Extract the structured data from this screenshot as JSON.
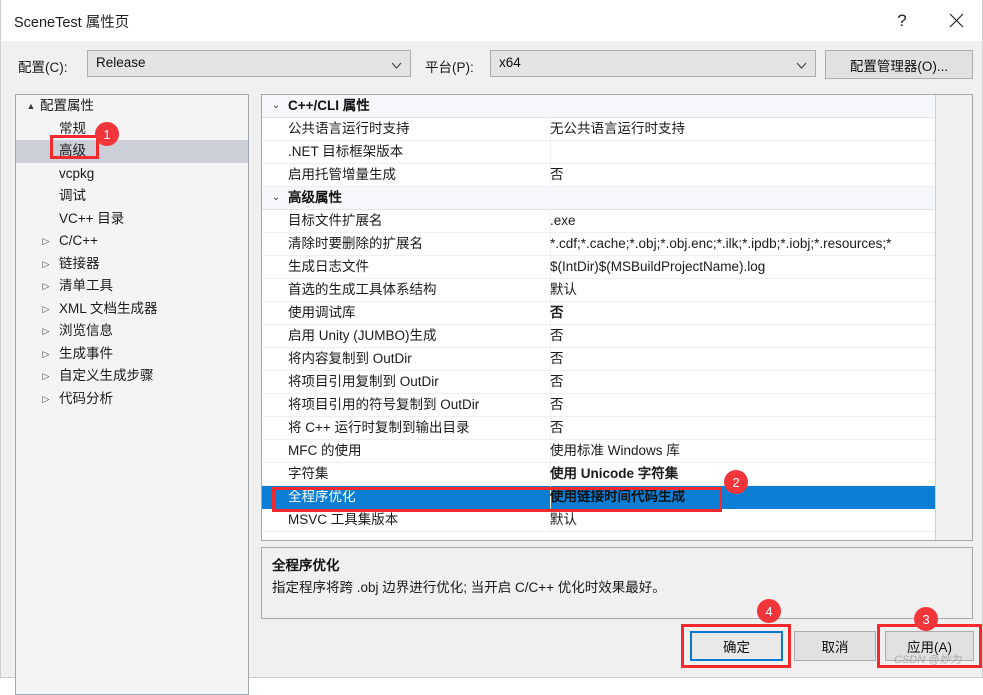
{
  "window": {
    "title": "SceneTest 属性页",
    "help_icon": "?",
    "close_icon": "close-icon"
  },
  "toolbar": {
    "config_label": "配置(C):",
    "config_value": "Release",
    "platform_label": "平台(P):",
    "platform_value": "x64",
    "config_manager_label": "配置管理器(O)..."
  },
  "tree": {
    "items": [
      {
        "label": "配置属性",
        "level": "root",
        "arrow": "▲",
        "selected": false
      },
      {
        "label": "常规",
        "level": "leaf",
        "arrow": "",
        "selected": false
      },
      {
        "label": "高级",
        "level": "leaf",
        "arrow": "",
        "selected": true
      },
      {
        "label": "vcpkg",
        "level": "leaf",
        "arrow": "",
        "selected": false
      },
      {
        "label": "调试",
        "level": "leaf",
        "arrow": "",
        "selected": false
      },
      {
        "label": "VC++ 目录",
        "level": "leaf",
        "arrow": "",
        "selected": false
      },
      {
        "label": "C/C++",
        "level": "node",
        "arrow": "▷",
        "selected": false
      },
      {
        "label": "链接器",
        "level": "node",
        "arrow": "▷",
        "selected": false
      },
      {
        "label": "清单工具",
        "level": "node",
        "arrow": "▷",
        "selected": false
      },
      {
        "label": "XML 文档生成器",
        "level": "node",
        "arrow": "▷",
        "selected": false
      },
      {
        "label": "浏览信息",
        "level": "node",
        "arrow": "▷",
        "selected": false
      },
      {
        "label": "生成事件",
        "level": "node",
        "arrow": "▷",
        "selected": false
      },
      {
        "label": "自定义生成步骤",
        "level": "node",
        "arrow": "▷",
        "selected": false
      },
      {
        "label": "代码分析",
        "level": "node",
        "arrow": "▷",
        "selected": false
      }
    ]
  },
  "grid": {
    "rows": [
      {
        "kind": "category",
        "name": "C++/CLI 属性",
        "value": "",
        "caret": "⌄",
        "bold": false,
        "selected": false
      },
      {
        "kind": "prop",
        "name": "公共语言运行时支持",
        "value": "无公共语言运行时支持",
        "bold": false,
        "selected": false
      },
      {
        "kind": "prop",
        "name": ".NET 目标框架版本",
        "value": "",
        "bold": false,
        "selected": false
      },
      {
        "kind": "prop",
        "name": "启用托管增量生成",
        "value": "否",
        "bold": false,
        "selected": false
      },
      {
        "kind": "category",
        "name": "高级属性",
        "value": "",
        "caret": "⌄",
        "bold": false,
        "selected": false
      },
      {
        "kind": "prop",
        "name": "目标文件扩展名",
        "value": ".exe",
        "bold": false,
        "selected": false
      },
      {
        "kind": "prop",
        "name": "清除时要删除的扩展名",
        "value": "*.cdf;*.cache;*.obj;*.obj.enc;*.ilk;*.ipdb;*.iobj;*.resources;*",
        "bold": false,
        "selected": false
      },
      {
        "kind": "prop",
        "name": "生成日志文件",
        "value": "$(IntDir)$(MSBuildProjectName).log",
        "bold": false,
        "selected": false
      },
      {
        "kind": "prop",
        "name": "首选的生成工具体系结构",
        "value": "默认",
        "bold": false,
        "selected": false
      },
      {
        "kind": "prop",
        "name": "使用调试库",
        "value": "否",
        "bold": true,
        "selected": false
      },
      {
        "kind": "prop",
        "name": "启用 Unity (JUMBO)生成",
        "value": "否",
        "bold": false,
        "selected": false
      },
      {
        "kind": "prop",
        "name": "将内容复制到 OutDir",
        "value": "否",
        "bold": false,
        "selected": false
      },
      {
        "kind": "prop",
        "name": "将项目引用复制到 OutDir",
        "value": "否",
        "bold": false,
        "selected": false
      },
      {
        "kind": "prop",
        "name": "将项目引用的符号复制到 OutDir",
        "value": "否",
        "bold": false,
        "selected": false
      },
      {
        "kind": "prop",
        "name": "将 C++ 运行时复制到输出目录",
        "value": "否",
        "bold": false,
        "selected": false
      },
      {
        "kind": "prop",
        "name": "MFC 的使用",
        "value": "使用标准 Windows 库",
        "bold": false,
        "selected": false
      },
      {
        "kind": "prop",
        "name": "字符集",
        "value": "使用 Unicode 字符集",
        "bold": true,
        "selected": false
      },
      {
        "kind": "prop",
        "name": "全程序优化",
        "value": "使用链接时间代码生成",
        "bold": true,
        "selected": true
      },
      {
        "kind": "prop",
        "name": "MSVC 工具集版本",
        "value": "默认",
        "bold": false,
        "selected": false
      }
    ]
  },
  "description": {
    "title": "全程序优化",
    "body": "指定程序将跨 .obj 边界进行优化; 当开启 C/C++ 优化时效果最好。"
  },
  "footer": {
    "ok_label": "确定",
    "cancel_label": "取消",
    "apply_label": "应用(A)"
  },
  "annotations": {
    "badges": [
      "1",
      "2",
      "3",
      "4"
    ],
    "highlight_color": "#f2292d",
    "badge_color": "#f2353a",
    "selection_color": "#0c7fd4"
  },
  "watermark": {
    "text": "CSDN @妙为"
  }
}
